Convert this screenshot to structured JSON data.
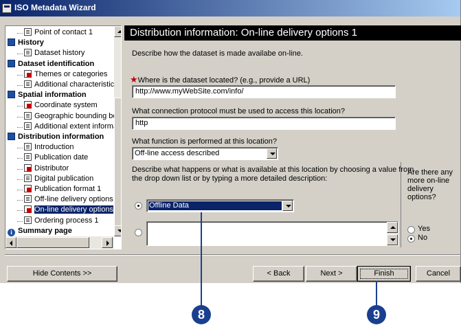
{
  "window": {
    "title": "ISO Metadata Wizard"
  },
  "tree": {
    "items": [
      {
        "label": "Point of contact 1",
        "icon": "page-icon",
        "level": 2
      },
      {
        "label": "History",
        "icon": "book-icon",
        "level": 1
      },
      {
        "label": "Dataset history",
        "icon": "page-icon",
        "level": 2
      },
      {
        "label": "Dataset identification",
        "icon": "book-icon",
        "level": 1
      },
      {
        "label": "Themes or categories",
        "icon": "required-page-icon",
        "level": 2
      },
      {
        "label": "Additional characteristics",
        "icon": "page-icon",
        "level": 2
      },
      {
        "label": "Spatial information",
        "icon": "book-icon",
        "level": 1
      },
      {
        "label": "Coordinate system",
        "icon": "required-page-icon",
        "level": 2
      },
      {
        "label": "Geographic bounding bo",
        "icon": "page-icon",
        "level": 2
      },
      {
        "label": "Additional extent informa",
        "icon": "page-icon",
        "level": 2
      },
      {
        "label": "Distribution information",
        "icon": "book-icon",
        "level": 1
      },
      {
        "label": "Introduction",
        "icon": "page-icon",
        "level": 2
      },
      {
        "label": "Publication date",
        "icon": "page-icon",
        "level": 2
      },
      {
        "label": "Distributor",
        "icon": "required-page-icon",
        "level": 2
      },
      {
        "label": "Digital publication",
        "icon": "page-icon",
        "level": 2
      },
      {
        "label": "Publication format 1",
        "icon": "required-page-icon",
        "level": 2
      },
      {
        "label": "Off-line delivery options",
        "icon": "page-icon",
        "level": 2
      },
      {
        "label": "On-line delivery options",
        "icon": "required-page-icon",
        "level": 2,
        "selected": true
      },
      {
        "label": "Ordering process 1",
        "icon": "page-icon",
        "level": 2
      },
      {
        "label": "Summary page",
        "icon": "info-icon",
        "level": 1
      }
    ]
  },
  "page": {
    "title": "Distribution information: On-line delivery options 1",
    "description": "Describe how the dataset is made availabe on-line.",
    "location_label": "Where is the dataset located? (e.g., provide a URL)",
    "location_value": "http://www.myWebSite.com/info/",
    "protocol_label": "What connection protocol must be used to access this location?",
    "protocol_value": "http",
    "function_label": "What function is performed at this location?",
    "function_value": "Off-line access described",
    "describe_label_1": "Describe what happens or what is available at this location by choosing a value from",
    "describe_label_2": "the drop down list or by typing a more detailed description:",
    "describe_combo_value": "Offline Data",
    "describe_text_value": "",
    "more_options_q": [
      "Are there any",
      "more on-line",
      "delivery",
      "options?"
    ],
    "yes_label": "Yes",
    "no_label": "No"
  },
  "buttons": {
    "hide_contents": "Hide Contents >>",
    "back": "< Back",
    "next": "Next >",
    "finish": "Finish",
    "cancel": "Cancel"
  },
  "callouts": {
    "step_8": "8",
    "step_9": "9",
    "color": "#1a3f8f"
  }
}
